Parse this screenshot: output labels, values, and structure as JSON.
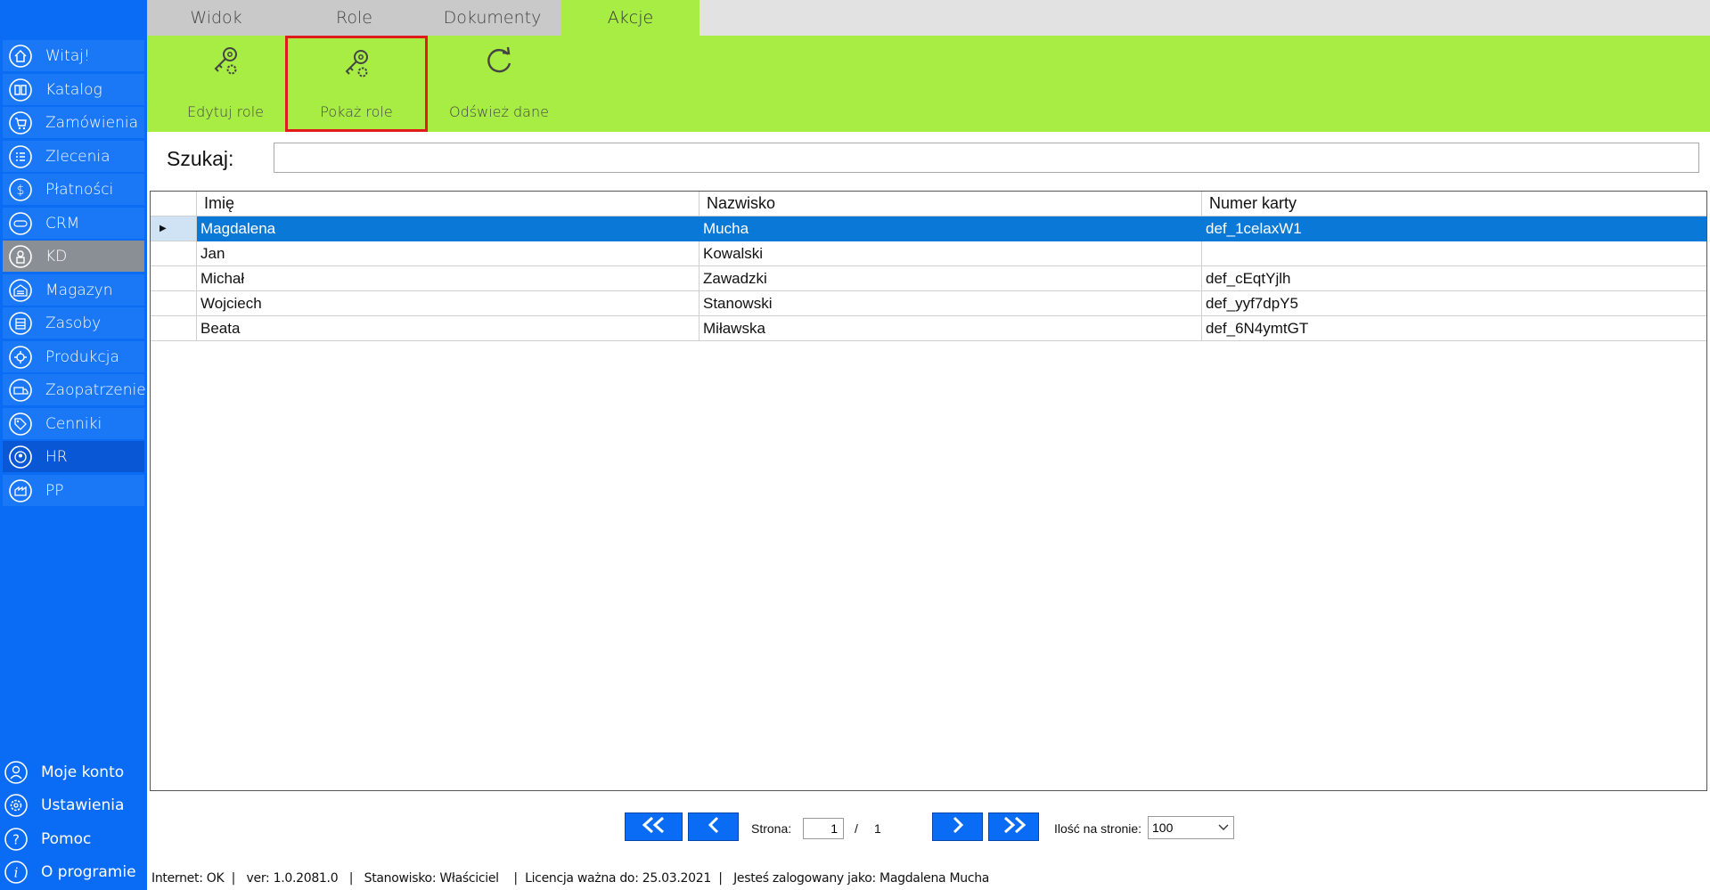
{
  "sidebar": {
    "items": [
      {
        "label": "Witaj!",
        "icon": "home-icon"
      },
      {
        "label": "Katalog",
        "icon": "book-icon"
      },
      {
        "label": "Zamówienia",
        "icon": "cart-icon"
      },
      {
        "label": "Zlecenia",
        "icon": "list-icon"
      },
      {
        "label": "Płatności",
        "icon": "dollar-icon"
      },
      {
        "label": "CRM",
        "icon": "crm-icon"
      },
      {
        "label": "KD",
        "icon": "user-lock-icon"
      },
      {
        "label": "Magazyn",
        "icon": "warehouse-icon"
      },
      {
        "label": "Zasoby",
        "icon": "resources-icon"
      },
      {
        "label": "Produkcja",
        "icon": "production-icon"
      },
      {
        "label": "Zaopatrzenie",
        "icon": "truck-icon"
      },
      {
        "label": "Cenniki",
        "icon": "price-tag-icon"
      },
      {
        "label": "HR",
        "icon": "hr-icon"
      },
      {
        "label": "PP",
        "icon": "pp-icon"
      }
    ],
    "bottom": [
      {
        "label": "Moje konto",
        "icon": "account-icon"
      },
      {
        "label": "Ustawienia",
        "icon": "settings-icon"
      },
      {
        "label": "Pomoc",
        "icon": "help-icon"
      },
      {
        "label": "O programie",
        "icon": "info-icon"
      }
    ]
  },
  "tabs": [
    "Widok",
    "Role",
    "Dokumenty",
    "Akcje"
  ],
  "active_tab": "Akcje",
  "ribbon": {
    "edit_roles": "Edytuj role",
    "show_roles": "Pokaż role",
    "refresh": "Odśwież dane"
  },
  "search": {
    "label": "Szukaj:",
    "value": ""
  },
  "grid": {
    "columns": [
      "Imię",
      "Nazwisko",
      "Numer karty"
    ],
    "rows": [
      [
        "Magdalena",
        "Mucha",
        "def_1celaxW1"
      ],
      [
        "Jan",
        "Kowalski",
        ""
      ],
      [
        "Michał",
        "Zawadzki",
        "def_cEqtYjlh"
      ],
      [
        "Wojciech",
        "Stanowski",
        "def_yyf7dpY5"
      ],
      [
        "Beata",
        "Miławska",
        "def_6N4ymtGT"
      ]
    ],
    "selected_row": 0
  },
  "pager": {
    "page_label": "Strona:",
    "current_page": "1",
    "separator": "/",
    "total_pages": "1",
    "per_page_label": "Ilość na stronie:",
    "per_page_value": "100"
  },
  "status": {
    "text": "Internet: OK  |   ver: 1.0.2081.0   |   Stanowisko: Właściciel    |  Licencja ważna do: 25.03.2021  |   Jesteś zalogowany jako: Magdalena Mucha"
  },
  "colors": {
    "sidebar": "#0a6cf5",
    "ribbon": "#a8ed44",
    "selection": "#0a78d7",
    "highlight_border": "#e01b1b"
  }
}
